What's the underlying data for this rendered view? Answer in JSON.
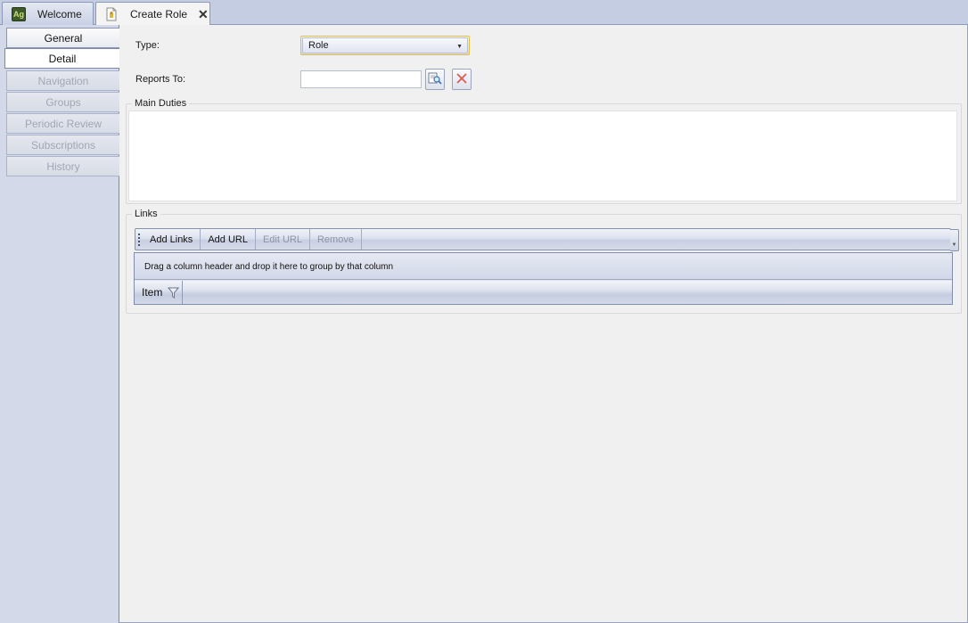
{
  "tabs": [
    {
      "label": "Welcome",
      "icon": "app-logo-icon"
    },
    {
      "label": "Create Role",
      "icon": "document-icon",
      "closable": true
    }
  ],
  "app_logo_text": "Ag",
  "nav": {
    "items": [
      {
        "label": "General",
        "state": "enabled"
      },
      {
        "label": "Detail",
        "state": "active"
      },
      {
        "label": "Navigation",
        "state": "disabled"
      },
      {
        "label": "Groups",
        "state": "disabled"
      },
      {
        "label": "Periodic Review",
        "state": "disabled"
      },
      {
        "label": "Subscriptions",
        "state": "disabled"
      },
      {
        "label": "History",
        "state": "disabled"
      }
    ]
  },
  "form": {
    "type_label": "Type:",
    "type_value": "Role",
    "reports_to_label": "Reports To:",
    "reports_to_value": "",
    "main_duties_label": "Main Duties",
    "main_duties_value": ""
  },
  "links": {
    "label": "Links",
    "toolbar": [
      {
        "label": "Add Links",
        "enabled": true
      },
      {
        "label": "Add URL",
        "enabled": true
      },
      {
        "label": "Edit URL",
        "enabled": false
      },
      {
        "label": "Remove",
        "enabled": false
      }
    ],
    "group_panel_text": "Drag a column header and drop it here to group by that column",
    "columns": [
      "Item"
    ]
  },
  "colors": {
    "focus_border": "#e6bd3a",
    "remove_icon": "#e05a4f",
    "nav_background": "#d4d9ea"
  }
}
